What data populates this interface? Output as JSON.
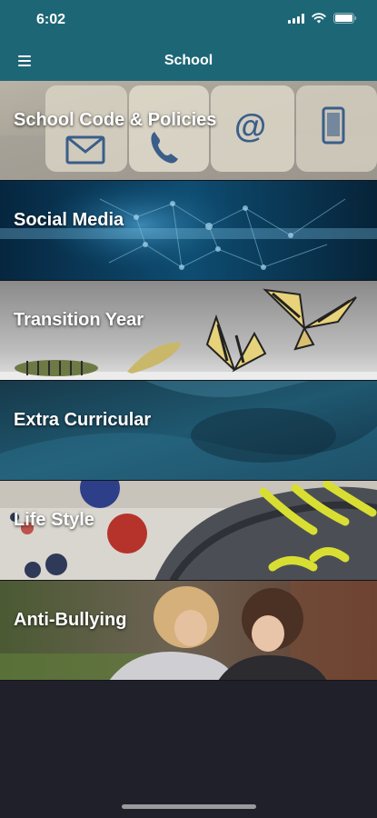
{
  "status": {
    "time": "6:02"
  },
  "nav": {
    "title": "School",
    "menu_icon": "hamburger-menu-icon"
  },
  "tiles": [
    {
      "label": "School Code & Policies",
      "icons": [
        "envelope-icon",
        "phone-icon",
        "at-sign-icon",
        "mobile-phone-icon"
      ]
    },
    {
      "label": "Social Media"
    },
    {
      "label": "Transition Year"
    },
    {
      "label": "Extra Curricular"
    },
    {
      "label": "Life Style"
    },
    {
      "label": "Anti-Bullying"
    }
  ],
  "colors": {
    "header": "#1d6676",
    "background": "#1f2029"
  }
}
